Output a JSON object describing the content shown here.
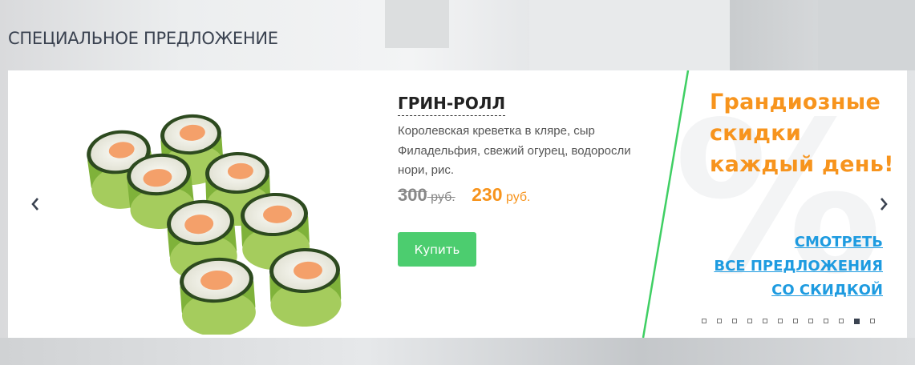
{
  "section": {
    "title": "СПЕЦИАЛЬНОЕ ПРЕДЛОЖЕНИЕ"
  },
  "product": {
    "name": "ГРИН-РОЛЛ",
    "description": "Королевская креветка в кляре, сыр Филадельфия, свежий огурец, водоросли нори, рис.",
    "old_price": "300",
    "old_currency": "руб.",
    "new_price": "230",
    "new_currency": "руб.",
    "buy_label": "Купить"
  },
  "promo": {
    "text": "Грандиозные скидки каждый день!",
    "link_lines": [
      "СМОТРЕТЬ",
      "ВСЕ ПРЕДЛОЖЕНИЯ",
      "СО СКИДКОЙ"
    ]
  },
  "carousel": {
    "prev_icon": "chevron-left-icon",
    "next_icon": "chevron-right-icon",
    "slide_count": 12,
    "active_slide": 10
  },
  "colors": {
    "accent_orange": "#f7941d",
    "buy_green": "#4ccd6f",
    "link_blue": "#1e9be0",
    "divider_green": "#3fcf63",
    "title_dark": "#3a4250"
  }
}
